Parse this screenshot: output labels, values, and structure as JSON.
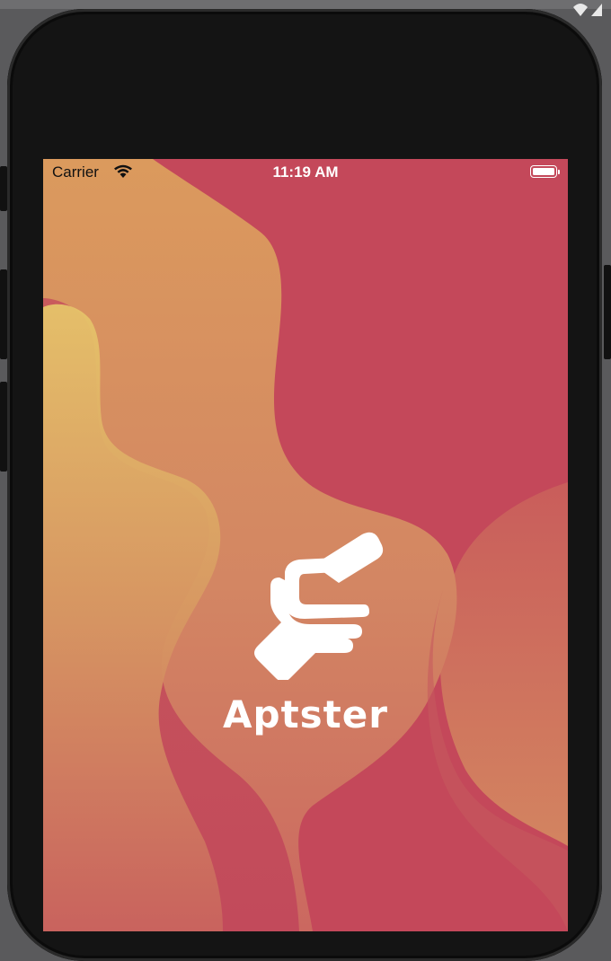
{
  "status_bar": {
    "carrier": "Carrier",
    "time": "11:19 AM",
    "wifi_icon": "wifi-icon",
    "battery_icon": "battery-icon"
  },
  "splash": {
    "app_name": "Aptster",
    "logo_icon": "handshake-logo-icon",
    "colors": {
      "background": "#c7485a",
      "wave_light": "#d9935f",
      "wave_highlight": "#e8c16a",
      "wave_accent": "#d07a5e",
      "foreground": "#ffffff"
    }
  }
}
